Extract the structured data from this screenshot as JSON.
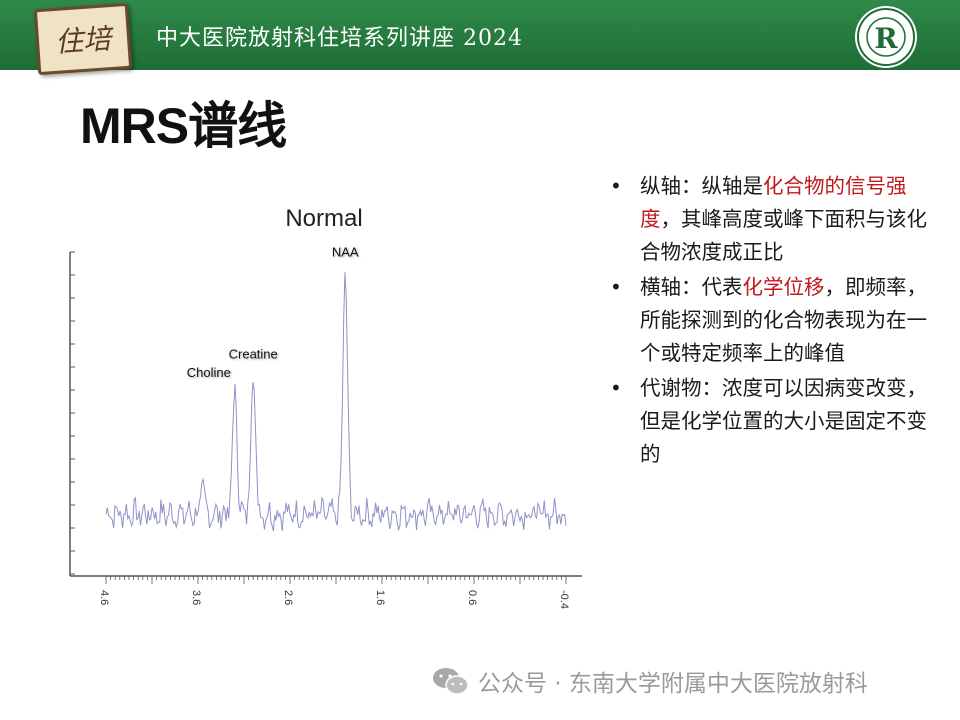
{
  "header": {
    "badge_text": "住培",
    "series_title": "中大医院放射科住培系列讲座 2024",
    "logo_icon": "hospital-seal-icon"
  },
  "slide": {
    "title": "MRS谱线"
  },
  "chart_data": {
    "type": "line",
    "title": "Normal",
    "x_ticks": [
      "4.6",
      "3.6",
      "2.6",
      "1.6",
      "0.6",
      "-0.4"
    ],
    "xlim": [
      4.6,
      -0.4
    ],
    "peaks": [
      {
        "name": "Choline",
        "x": 3.2,
        "height": 0.47
      },
      {
        "name": "Creatine",
        "x": 3.0,
        "height": 0.54
      },
      {
        "name": "NAA",
        "x": 2.0,
        "height": 0.93
      }
    ],
    "line_color": "#8f92c8"
  },
  "bullets": [
    {
      "parts": [
        {
          "text": "纵轴：纵轴是",
          "hl": false
        },
        {
          "text": "化合物的信号强度",
          "hl": true
        },
        {
          "text": "，其峰高度或峰下面积与该化合物浓度成正比",
          "hl": false
        }
      ]
    },
    {
      "parts": [
        {
          "text": "横轴：代表",
          "hl": false
        },
        {
          "text": "化学位移",
          "hl": true
        },
        {
          "text": "，即频率，所能探测到的化合物表现为在一个或特定频率上的峰值",
          "hl": false
        }
      ]
    },
    {
      "parts": [
        {
          "text": "代谢物：浓度可以因病变改变，但是化学位置的大小是固定不变的",
          "hl": false
        }
      ]
    }
  ],
  "footer": {
    "text": "公众号 · 东南大学附属中大医院放射科",
    "icon": "wechat-icon"
  }
}
